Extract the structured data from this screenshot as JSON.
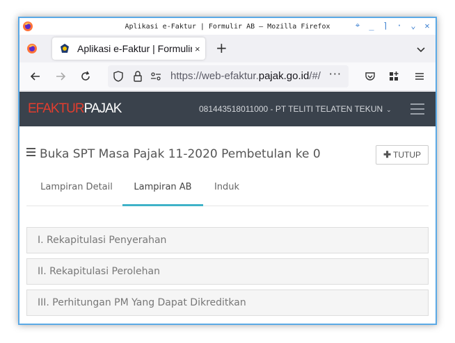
{
  "window": {
    "title": "Aplikasi e-Faktur | Formulir AB — Mozilla Firefox"
  },
  "browser": {
    "tab_title": "Aplikasi e-Faktur | Formulir AB",
    "tab_close": "×",
    "new_tab": "+",
    "url_prefix": "https://web-efaktur.",
    "url_host": "pajak.go.id",
    "url_suffix": "/#/",
    "url_more": "···"
  },
  "app": {
    "brand_part1": "EFAKTUR",
    "brand_part2": "PAJAK",
    "user_label": "081443518011000 - PT TELITI TELATEN TEKUN",
    "page_title": "Buka SPT Masa Pajak 11-2020 Pembetulan ke 0",
    "close_button_label": "TUTUP",
    "tabs": [
      {
        "label": "Lampiran Detail",
        "active": false
      },
      {
        "label": "Lampiran AB",
        "active": true
      },
      {
        "label": "Induk",
        "active": false
      }
    ],
    "panels": [
      {
        "label": "I. Rekapitulasi Penyerahan"
      },
      {
        "label": "II. Rekapitulasi Perolehan"
      },
      {
        "label": "III. Perhitungan PM Yang Dapat Dikreditkan"
      }
    ]
  },
  "colors": {
    "header_bg": "#3a424c",
    "brand_red": "#e23d2e",
    "active_tab_underline": "#3fb2c8",
    "window_border": "#5aa9e6"
  }
}
